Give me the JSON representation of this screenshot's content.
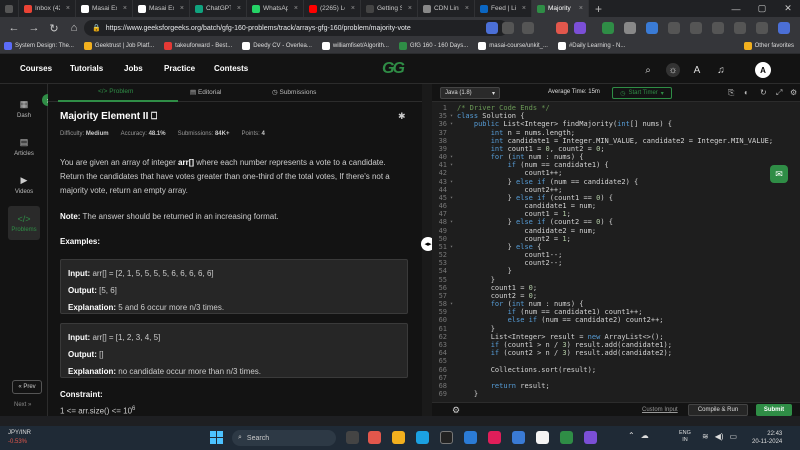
{
  "browser": {
    "tabs": [
      {
        "label": "Inbox (42)",
        "color": "#ea4335"
      },
      {
        "label": "Masai Exp",
        "color": "#ffffff"
      },
      {
        "label": "Masai Exp",
        "color": "#ffffff"
      },
      {
        "label": "ChatGPT",
        "color": "#10a37f"
      },
      {
        "label": "WhatsApp",
        "color": "#25d366"
      },
      {
        "label": "(2265) Lee",
        "color": "#ff0000"
      },
      {
        "label": "Getting St",
        "color": "#444444"
      },
      {
        "label": "CDN Links",
        "color": "#888888"
      },
      {
        "label": "Feed | Link",
        "color": "#0a66c2"
      },
      {
        "label": "Majority E",
        "color": "#2f8d46"
      }
    ],
    "new_tab": "+",
    "url": "https://www.geeksforgeeks.org/batch/gfg-160-problems/track/arrays-gfg-160/problem/majority-vote",
    "bookmarks": [
      {
        "label": "System Design: The...",
        "color": "#5b6cf9"
      },
      {
        "label": "Geektrust | Job Platf...",
        "color": "#f2b01e"
      },
      {
        "label": "takeuforward - Best...",
        "color": "#e53935"
      },
      {
        "label": "Deedy CV - Overlea...",
        "color": "#ffffff"
      },
      {
        "label": "williamfiset/Algorith...",
        "color": "#ffffff"
      },
      {
        "label": "GfG 160 - 160 Days...",
        "color": "#2f8d46"
      },
      {
        "label": "masai-course/unkit_...",
        "color": "#ffffff"
      },
      {
        "label": "#Daily Learning - N...",
        "color": "#ffffff"
      }
    ],
    "other_favorites": "Other favorites"
  },
  "gfg_header": {
    "menus": [
      "Courses",
      "Tutorials",
      "Jobs",
      "Practice",
      "Contests"
    ],
    "logo": "GG",
    "avatar": "A"
  },
  "sidebar": {
    "items": [
      {
        "label": "Dash",
        "icon": "grid-icon"
      },
      {
        "label": "Articles",
        "icon": "article-icon"
      },
      {
        "label": "Videos",
        "icon": "video-icon"
      },
      {
        "label": "Problems",
        "icon": "code-icon"
      }
    ],
    "prev": "« Prev",
    "next": "Next »"
  },
  "problem": {
    "tabs": [
      "Problem",
      "Editorial",
      "Submissions"
    ],
    "title": "Majority Element II",
    "meta": {
      "difficulty_label": "Difficulty:",
      "difficulty": "Medium",
      "accuracy_label": "Accuracy:",
      "accuracy": "48.1%",
      "submissions_label": "Submissions:",
      "submissions": "84K+",
      "points_label": "Points:",
      "points": "4"
    },
    "desc_pre": "You are given an array of integer ",
    "desc_bold": "arr[]",
    "desc_post": " where each number represents a vote to a candidate. Return the candidates that have votes greater than one-third of the total votes, If there's not a majority vote, return an empty array.",
    "note_label": "Note:",
    "note_text": " The answer should be returned in an increasing format.",
    "examples_heading": "Examples:",
    "examples": [
      {
        "input_label": "Input:",
        "input": " arr[] = [2, 1, 5, 5, 5, 5, 6, 6, 6, 6, 6]",
        "output_label": "Output:",
        "output": " [5, 6]",
        "expl_label": "Explanation:",
        "expl": " 5 and 6 occur more n/3 times."
      },
      {
        "input_label": "Input:",
        "input": " arr[] = [1, 2, 3, 4, 5]",
        "output_label": "Output:",
        "output": " []",
        "expl_label": "Explanation:",
        "expl": " no candidate occur more than n/3 times."
      }
    ],
    "constraint_heading": "Constraint:",
    "constraint_text": "1 <= arr.size() <= 10",
    "constraint_sup": "6"
  },
  "editor": {
    "language": "Java (1.8)",
    "avg_time": "Average Time: 15m",
    "timer": "Start Timer",
    "custom_input": "Custom Input",
    "compile": "Compile & Run",
    "submit": "Submit",
    "code_lines": [
      {
        "n": "1",
        "t": "/* Driver Code Ends */"
      },
      {
        "n": "35",
        "t": "class Solution {"
      },
      {
        "n": "36",
        "t": "    public List<Integer> findMajority(int[] nums) {"
      },
      {
        "n": "37",
        "t": "        int n = nums.length;"
      },
      {
        "n": "38",
        "t": "        int candidate1 = Integer.MIN_VALUE, candidate2 = Integer.MIN_VALUE;"
      },
      {
        "n": "39",
        "t": "        int count1 = 0, count2 = 0;"
      },
      {
        "n": "40",
        "t": "        for (int num : nums) {"
      },
      {
        "n": "41",
        "t": "            if (num == candidate1) {"
      },
      {
        "n": "42",
        "t": "                count1++;"
      },
      {
        "n": "43",
        "t": "            } else if (num == candidate2) {"
      },
      {
        "n": "44",
        "t": "                count2++;"
      },
      {
        "n": "45",
        "t": "            } else if (count1 == 0) {"
      },
      {
        "n": "46",
        "t": "                candidate1 = num;"
      },
      {
        "n": "47",
        "t": "                count1 = 1;"
      },
      {
        "n": "48",
        "t": "            } else if (count2 == 0) {"
      },
      {
        "n": "49",
        "t": "                candidate2 = num;"
      },
      {
        "n": "50",
        "t": "                count2 = 1;"
      },
      {
        "n": "51",
        "t": "            } else {"
      },
      {
        "n": "52",
        "t": "                count1--;"
      },
      {
        "n": "53",
        "t": "                count2--;"
      },
      {
        "n": "54",
        "t": "            }"
      },
      {
        "n": "55",
        "t": "        }"
      },
      {
        "n": "56",
        "t": "        count1 = 0;"
      },
      {
        "n": "57",
        "t": "        count2 = 0;"
      },
      {
        "n": "58",
        "t": "        for (int num : nums) {"
      },
      {
        "n": "59",
        "t": "            if (num == candidate1) count1++;"
      },
      {
        "n": "60",
        "t": "            else if (num == candidate2) count2++;"
      },
      {
        "n": "61",
        "t": "        }"
      },
      {
        "n": "62",
        "t": "        List<Integer> result = new ArrayList<>();"
      },
      {
        "n": "63",
        "t": "        if (count1 > n / 3) result.add(candidate1);"
      },
      {
        "n": "64",
        "t": "        if (count2 > n / 3) result.add(candidate2);"
      },
      {
        "n": "65",
        "t": ""
      },
      {
        "n": "66",
        "t": "        Collections.sort(result);"
      },
      {
        "n": "67",
        "t": ""
      },
      {
        "n": "68",
        "t": "        return result;"
      },
      {
        "n": "69",
        "t": "    }"
      }
    ]
  },
  "taskbar": {
    "weather_title": "JPY/INR",
    "weather_change": "-0.53%",
    "search_placeholder": "Search",
    "lang_line1": "ENG",
    "lang_line2": "IN",
    "time": "22:43",
    "date": "20-11-2024"
  },
  "colors": {
    "accent": "#2f8d46"
  }
}
